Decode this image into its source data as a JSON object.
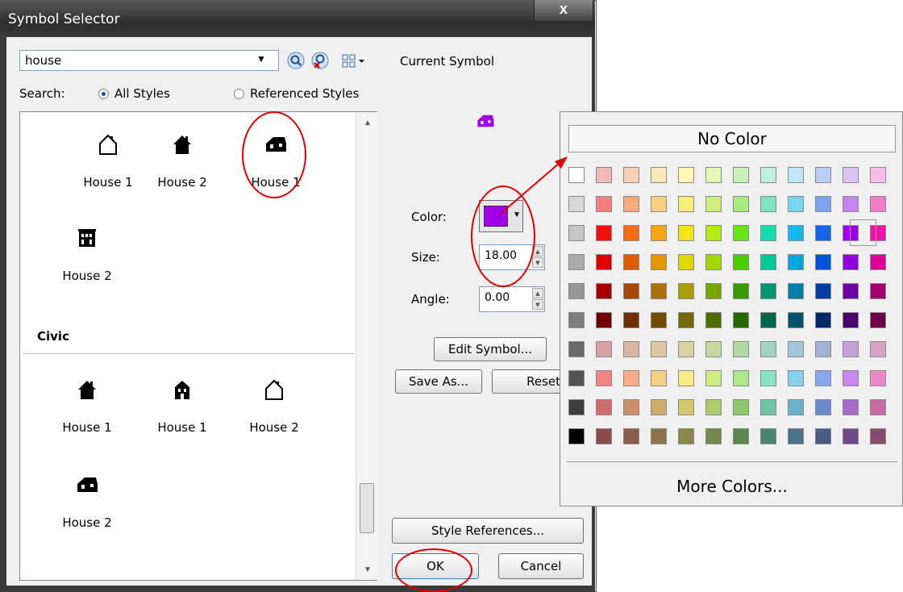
{
  "window": {
    "title": "Symbol Selector",
    "close_label": "x"
  },
  "search": {
    "value": "house",
    "scope_label": "Search:",
    "all_styles": "All Styles",
    "referenced_styles": "Referenced Styles"
  },
  "groups": [
    {
      "name": "",
      "items": [
        {
          "label": "House 1",
          "icon": "house-outline-icon"
        },
        {
          "label": "House 2",
          "icon": "house-solid-icon"
        },
        {
          "label": "House 1",
          "icon": "house-side-icon"
        },
        {
          "label": "House 2",
          "icon": "building-icon"
        }
      ]
    },
    {
      "name": "Civic",
      "items": [
        {
          "label": "House 1",
          "icon": "house-solid-icon"
        },
        {
          "label": "House 1",
          "icon": "house-large-icon"
        },
        {
          "label": "House 2",
          "icon": "house-outline-icon"
        },
        {
          "label": "House 2",
          "icon": "house-side-icon"
        }
      ]
    }
  ],
  "current_symbol": {
    "label": "Current Symbol",
    "color": "#a000e8"
  },
  "properties": {
    "color_label": "Color:",
    "color_value": "#a000e8",
    "size_label": "Size:",
    "size_value": "18.00",
    "angle_label": "Angle:",
    "angle_value": "0.00"
  },
  "buttons": {
    "edit_symbol": "Edit Symbol...",
    "save_as": "Save As...",
    "reset": "Reset",
    "style_references": "Style References...",
    "ok": "OK",
    "cancel": "Cancel"
  },
  "color_picker": {
    "no_color": "No Color",
    "more_colors": "More Colors...",
    "selected": "#a000e8",
    "rows": [
      [
        "#ffffff",
        "#f5b7b7",
        "#f9d2b6",
        "#fbe6b6",
        "#fbf7b4",
        "#e6f6b3",
        "#ccf3b7",
        "#bff0df",
        "#bde9f6",
        "#bccdf5",
        "#e0c1f6",
        "#f7bce3"
      ],
      [
        "#d8d8d8",
        "#f57f7f",
        "#f7aa7c",
        "#f8cf7c",
        "#f7ef79",
        "#cfef79",
        "#a6ec7f",
        "#7de4c2",
        "#79d6f1",
        "#7aa4ee",
        "#c585ee",
        "#ef7dc7"
      ],
      [
        "#c6c6c6",
        "#ef1111",
        "#f26b15",
        "#f5a611",
        "#f2e715",
        "#b6ea14",
        "#63e21a",
        "#15dcae",
        "#14b9ef",
        "#1564ea",
        "#a000e8",
        "#f012a8"
      ],
      [
        "#ababab",
        "#e00000",
        "#dc5d00",
        "#e39600",
        "#e0d600",
        "#a2d700",
        "#49cf00",
        "#00c896",
        "#00a7dc",
        "#0054d8",
        "#9200d8",
        "#dc0096"
      ],
      [
        "#969696",
        "#a80000",
        "#a64600",
        "#aa7000",
        "#a8a000",
        "#7aa200",
        "#379b00",
        "#009670",
        "#007ea6",
        "#003fa2",
        "#6e00a2",
        "#a50070"
      ],
      [
        "#7d7d7d",
        "#700000",
        "#6e2e00",
        "#714b00",
        "#706b00",
        "#516c00",
        "#246800",
        "#006449",
        "#00546e",
        "#002a6c",
        "#49006c",
        "#6e004b"
      ],
      [
        "#686868",
        "#d9a1a1",
        "#d9b6a1",
        "#d9c8a1",
        "#d9d4a1",
        "#c8d8a1",
        "#b4d8a1",
        "#a1d4c2",
        "#a1c7d9",
        "#a1b1d8",
        "#c4a1d8",
        "#d8a1c6"
      ],
      [
        "#535353",
        "#f28383",
        "#f7ab87",
        "#f5d083",
        "#f5ec83",
        "#d0ec83",
        "#abea87",
        "#87e4c4",
        "#87d0f0",
        "#87a6ee",
        "#c687ee",
        "#ee87c6"
      ],
      [
        "#3e3e3e",
        "#cf6b6b",
        "#cf8e6b",
        "#cfae6b",
        "#cfc86b",
        "#aecb6b",
        "#8cc96b",
        "#6bc4a6",
        "#6bb1cd",
        "#6b8acb",
        "#a56bcb",
        "#cb6ba6"
      ],
      [
        "#000000",
        "#8c4a4a",
        "#8c5c4a",
        "#8c744a",
        "#8c864a",
        "#738a4a",
        "#5a884a",
        "#4a8472",
        "#4a7288",
        "#4a5c88",
        "#6e4a88",
        "#884a6e"
      ]
    ]
  }
}
